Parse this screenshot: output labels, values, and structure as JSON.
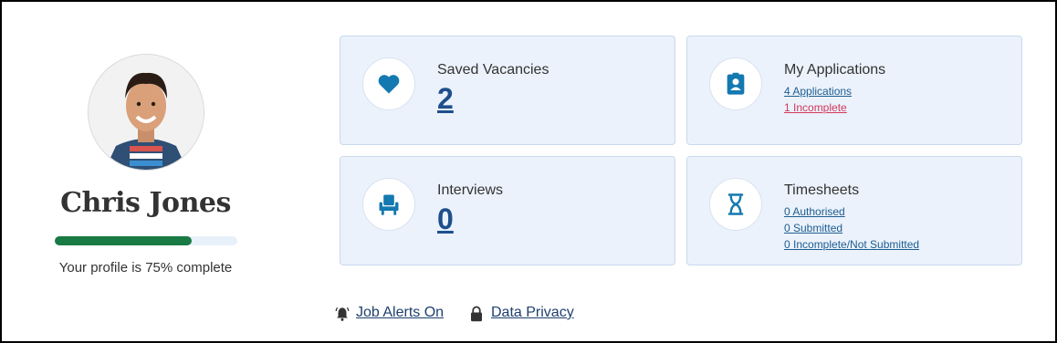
{
  "profile": {
    "name": "Chris Jones",
    "completion_percent": 75,
    "completion_text": "Your profile is 75% complete"
  },
  "cards": {
    "saved_vacancies": {
      "title": "Saved Vacancies",
      "count": "2",
      "icon": "heart-icon"
    },
    "my_applications": {
      "title": "My Applications",
      "links": [
        "4 Applications",
        "1 Incomplete"
      ],
      "icon": "clipboard-badge-icon"
    },
    "interviews": {
      "title": "Interviews",
      "count": "0",
      "icon": "chair-icon"
    },
    "timesheets": {
      "title": "Timesheets",
      "links": [
        "0 Authorised",
        "0 Submitted",
        "0 Incomplete/Not Submitted"
      ],
      "icon": "hourglass-icon"
    }
  },
  "footer": {
    "job_alerts": "Job Alerts On",
    "data_privacy": "Data Privacy"
  },
  "colors": {
    "accent_blue": "#1479b0",
    "card_bg": "#ebf2fc",
    "progress_green": "#1a7a44",
    "warning_red": "#d4375a"
  }
}
